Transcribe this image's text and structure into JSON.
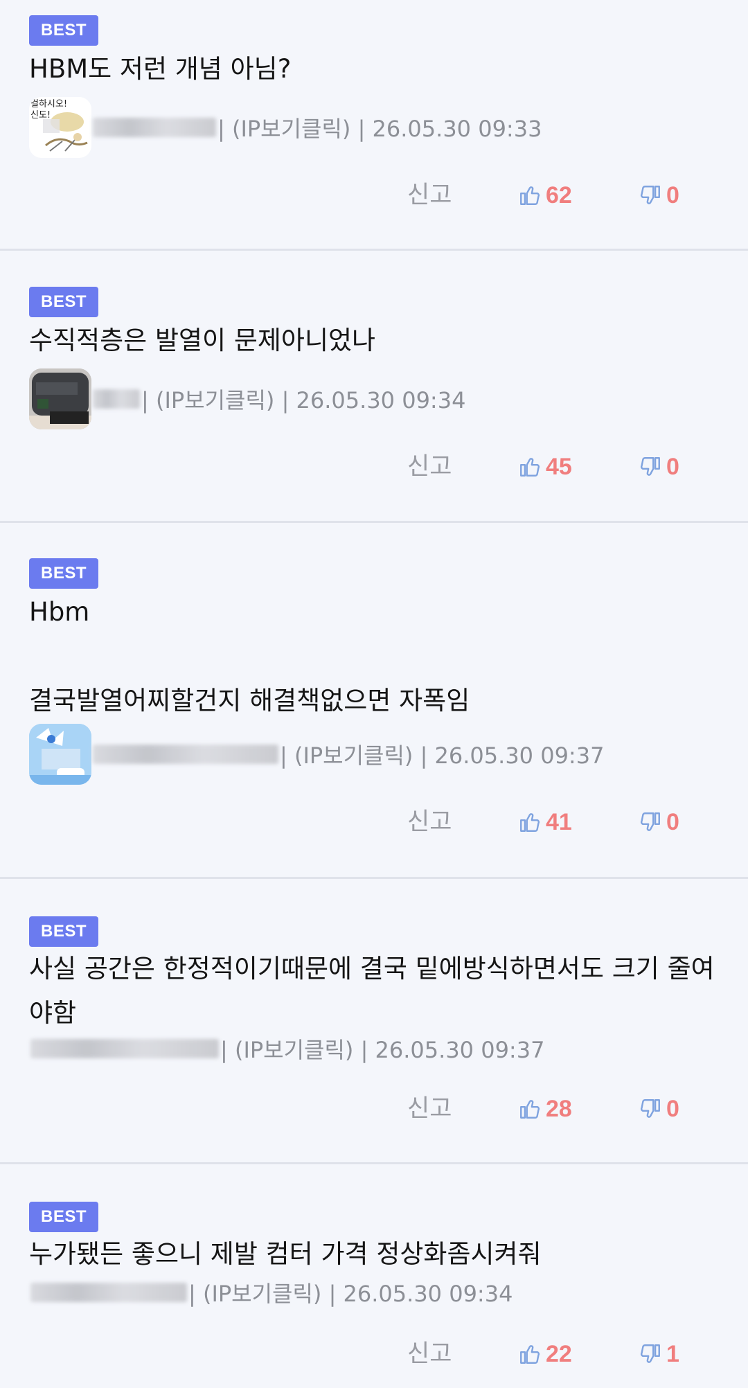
{
  "comments": [
    {
      "badge": "BEST",
      "text": "HBM도 저런 개념 아님?",
      "meta": "| (IP보기클릭) | 26.05.30 09:33",
      "report": "신고",
      "likes": "62",
      "dislikes": "0",
      "avatar_icon": "cartoon-avatar-icon"
    },
    {
      "badge": "BEST",
      "text": "수직적층은 발열이 문제아니었나",
      "meta": "| (IP보기클릭) | 26.05.30 09:34",
      "report": "신고",
      "likes": "45",
      "dislikes": "0",
      "avatar_icon": "photo-avatar-icon"
    },
    {
      "badge": "BEST",
      "text": "Hbm\n\n결국발열어찌할건지 해결책없으면 자폭임",
      "meta": "| (IP보기클릭) | 26.05.30 09:37",
      "report": "신고",
      "likes": "41",
      "dislikes": "0",
      "avatar_icon": "anime-avatar-icon"
    },
    {
      "badge": "BEST",
      "text": "사실 공간은 한정적이기때문에 결국 밑에방식하면서도 크기 줄여야함",
      "meta": "| (IP보기클릭) | 26.05.30 09:37",
      "report": "신고",
      "likes": "28",
      "dislikes": "0"
    },
    {
      "badge": "BEST",
      "text": "누가됐든 좋으니 제발 컴터 가격 정상화좀시켜줘",
      "meta": "| (IP보기클릭) | 26.05.30 09:34",
      "report": "신고",
      "likes": "22",
      "dislikes": "1"
    }
  ],
  "colors": {
    "background": "#f4f6fb",
    "badge": "#6b7bef",
    "count": "#f07e7e",
    "thumb_icon": "#7fa3df",
    "meta_text": "#8c8f96",
    "divider": "#dfe2ea"
  }
}
